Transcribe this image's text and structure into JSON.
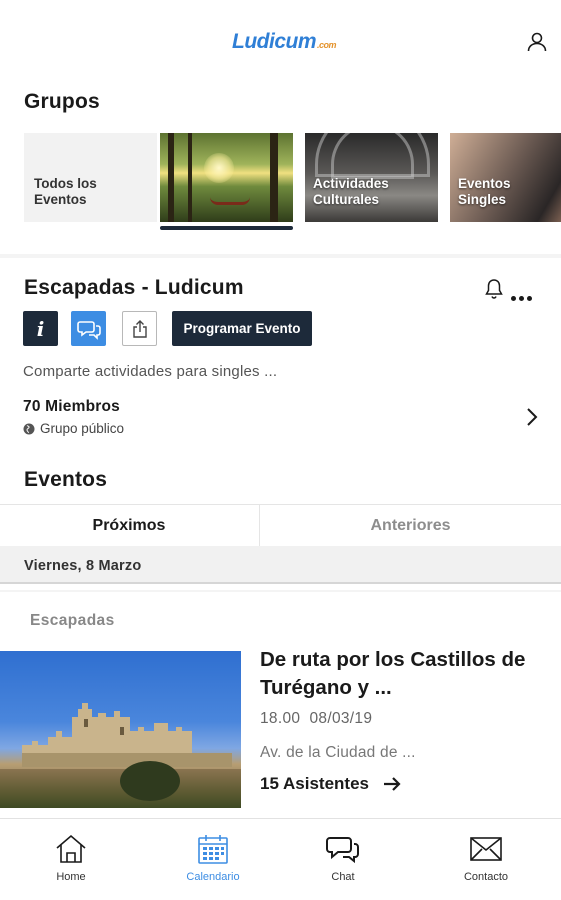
{
  "header": {
    "logo_text": "Ludicum",
    "logo_sub": ".com"
  },
  "groups": {
    "title": "Grupos",
    "cards": [
      {
        "label": "Todos los Eventos"
      },
      {
        "label": ""
      },
      {
        "label": "Actividades Culturales"
      },
      {
        "label": "Eventos Singles"
      }
    ],
    "selected_index": 1
  },
  "group_detail": {
    "title": "Escapadas - Ludicum",
    "info_label": "i",
    "program_button": "Programar Evento",
    "description": "Comparte actividades para singles ...",
    "members": "70 Miembros",
    "visibility": "Grupo público"
  },
  "events": {
    "title": "Eventos",
    "tabs": [
      {
        "label": "Próximos",
        "active": true
      },
      {
        "label": "Anteriores",
        "active": false
      }
    ],
    "date_header": "Viernes, 8 Marzo",
    "category": "Escapadas",
    "items": [
      {
        "title": "De ruta por los Castillos de Turégano y ...",
        "time": "18.00  08/03/19",
        "place": "Av. de la Ciudad de ...",
        "attendees": "15 Asistentes"
      }
    ]
  },
  "nav": {
    "items": [
      {
        "label": "Home",
        "icon": "home-icon"
      },
      {
        "label": "Calendario",
        "icon": "calendar-icon",
        "active": true
      },
      {
        "label": "Chat",
        "icon": "chat-icon"
      },
      {
        "label": "Contacto",
        "icon": "envelope-icon"
      }
    ]
  },
  "colors": {
    "accent": "#3d8de3",
    "dark": "#1d2a3a",
    "logo_orange": "#e4932c"
  }
}
